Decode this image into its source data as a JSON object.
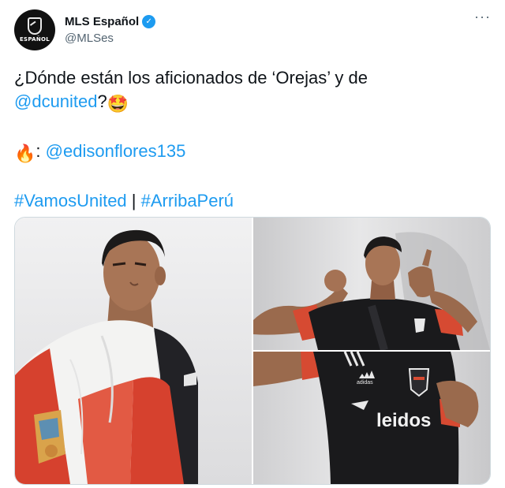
{
  "tweet": {
    "display_name": "MLS Español",
    "handle": "@MLSes",
    "avatar_text": "ESPAÑOL",
    "verified_icon": "verified-badge-icon",
    "more_icon": "more-options-icon",
    "line1": "¿Dónde están los aficionados de ‘Orejas’ y de",
    "mention_dcunited": "@dcunited",
    "question_mark": "?",
    "emoji_star": "🤩",
    "emoji_fire": "🔥",
    "colon": ":",
    "mention_edison": "@edisonflores135",
    "hashtag_vamos": "#VamosUnited",
    "separator": "|",
    "hashtag_arriba": "#ArribaPerú",
    "media_sponsor_text": "leidos",
    "media_brand_text": "adidas"
  },
  "colors": {
    "link": "#1d9bf0",
    "text": "#0f1419",
    "secondary": "#536471",
    "verified": "#1d9bf0",
    "peru_red": "#d6412e",
    "jersey_black": "#1a1a1c"
  }
}
